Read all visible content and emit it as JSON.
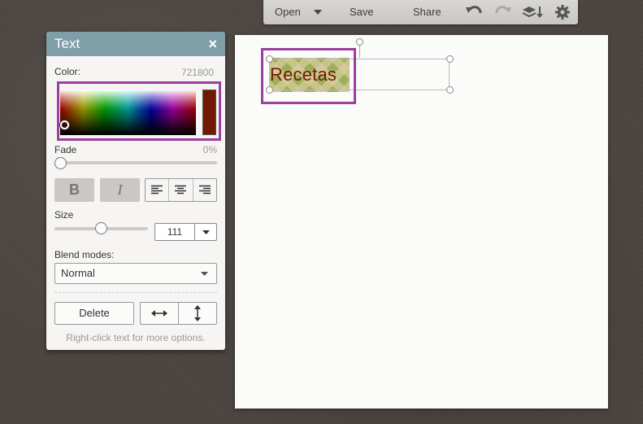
{
  "toolbar": {
    "open_label": "Open",
    "save_label": "Save",
    "share_label": "Share"
  },
  "panel": {
    "title": "Text",
    "close_glyph": "×",
    "color_label": "Color:",
    "color_hex": "721800",
    "fade_label": "Fade",
    "fade_value": "0%",
    "fade_level": 0,
    "bold_glyph": "B",
    "italic_glyph": "I",
    "size_label": "Size",
    "size_value": "111",
    "blend_label": "Blend modes:",
    "blend_value": "Normal",
    "delete_label": "Delete",
    "hint": "Right-click text for more options."
  },
  "canvas": {
    "text": "Recetas",
    "text_color": "#721800"
  },
  "colors": {
    "panel_header": "#7f9ea8",
    "highlight": "#9b3fa0",
    "swatch": "#721800"
  },
  "icons": [
    "chevron-down-icon",
    "undo-icon",
    "redo-icon",
    "layers-icon",
    "gear-icon",
    "close-icon",
    "align-left-icon",
    "align-center-icon",
    "align-right-icon",
    "flip-horizontal-icon",
    "flip-vertical-icon"
  ]
}
